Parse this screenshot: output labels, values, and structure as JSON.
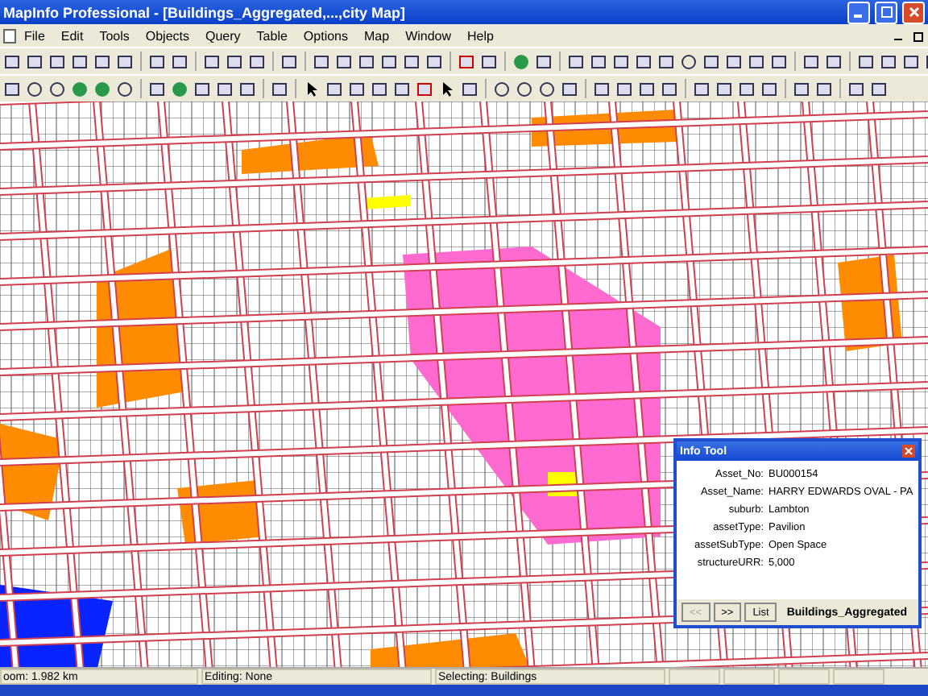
{
  "window": {
    "title": "MapInfo Professional - [Buildings_Aggregated,...,city Map]"
  },
  "menu": [
    "File",
    "Edit",
    "Tools",
    "Objects",
    "Query",
    "Table",
    "Options",
    "Map",
    "Window",
    "Help"
  ],
  "info_tool": {
    "title": "Info Tool",
    "fields": [
      {
        "label": "Asset_No:",
        "value": "BU000154"
      },
      {
        "label": "Asset_Name:",
        "value": "HARRY EDWARDS OVAL - PA"
      },
      {
        "label": "suburb:",
        "value": "Lambton"
      },
      {
        "label": "assetType:",
        "value": "Pavilion"
      },
      {
        "label": "assetSubType:",
        "value": "Open Space"
      },
      {
        "label": "structureURR:",
        "value": "5,000"
      }
    ],
    "buttons": [
      {
        "label": "<<",
        "disabled": true
      },
      {
        "label": ">>",
        "disabled": false
      },
      {
        "label": "List",
        "disabled": false
      }
    ],
    "table_name": "Buildings_Aggregated"
  },
  "status_bar": [
    "oom: 1.982 km",
    "Editing: None",
    "Selecting: Buildings"
  ]
}
